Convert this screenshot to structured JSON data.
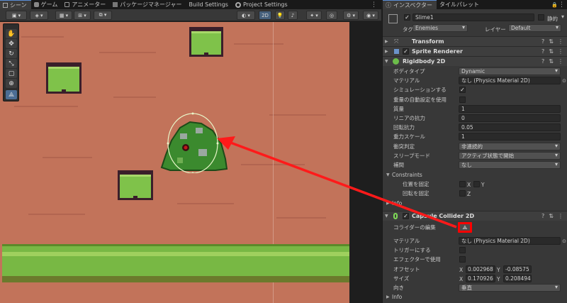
{
  "scene_tabs": [
    {
      "label": "シーン",
      "icon": "grid-icon",
      "active": true
    },
    {
      "label": "ゲーム",
      "icon": "gamepad-icon",
      "active": false
    },
    {
      "label": "アニメーター",
      "icon": "animator-icon",
      "active": false
    },
    {
      "label": "パッケージマネージャー",
      "icon": "package-icon",
      "active": false
    },
    {
      "label": "Build Settings",
      "icon": "",
      "active": false
    },
    {
      "label": "Project Settings",
      "icon": "gear-icon",
      "active": false
    }
  ],
  "scene_toolbar": {
    "mode_2d": "2D"
  },
  "tools": [
    "hand-icon",
    "move-icon",
    "rotate-icon",
    "scale-icon",
    "rect-icon",
    "transform-icon",
    "custom-tool-icon"
  ],
  "inspector": {
    "tabs": [
      {
        "label": "インスペクター",
        "icon": "info-icon",
        "active": true
      },
      {
        "label": "タイルパレット",
        "icon": "",
        "active": false
      }
    ],
    "object": {
      "name": "Slime1",
      "static_label": "静的",
      "tag_label": "タグ",
      "tag_value": "Enemies",
      "layer_label": "レイヤー",
      "layer_value": "Default"
    },
    "components": {
      "transform": "Transform",
      "sprite_renderer": "Sprite Renderer",
      "rigidbody": "Rigidbody 2D",
      "capsule": "Capsule Collider 2D"
    },
    "rigidbody_fields": [
      {
        "label": "ボディタイプ",
        "value": "Dynamic",
        "kind": "dropdown"
      },
      {
        "label": "マテリアル",
        "value": "なし (Physics Material 2D)",
        "kind": "object"
      },
      {
        "label": "シミュレーションする",
        "value": "✓",
        "kind": "check"
      },
      {
        "label": "重量の自動設定を使用",
        "value": "",
        "kind": "check"
      },
      {
        "label": "質量",
        "value": "1",
        "kind": "text"
      },
      {
        "label": "リニアの抗力",
        "value": "0",
        "kind": "text"
      },
      {
        "label": "回転抗力",
        "value": "0.05",
        "kind": "text"
      },
      {
        "label": "重力スケール",
        "value": "1",
        "kind": "text"
      },
      {
        "label": "衝突判定",
        "value": "非連続的",
        "kind": "dropdown"
      },
      {
        "label": "スリープモード",
        "value": "アクティブ状態で開始",
        "kind": "dropdown"
      },
      {
        "label": "補間",
        "value": "なし",
        "kind": "dropdown"
      }
    ],
    "constraints": {
      "title": "Constraints",
      "freeze_pos_label": "位置を固定",
      "freeze_rot_label": "回転を固定",
      "x": "X",
      "y": "Y",
      "z": "Z"
    },
    "info_label": "Info",
    "capsule_fields": {
      "edit_label": "コライダーの編集",
      "material_label": "マテリアル",
      "material_value": "なし (Physics Material 2D)",
      "trigger_label": "トリガーにする",
      "effector_label": "エフェクターで使用",
      "offset_label": "オフセット",
      "offset_x": "0.002968",
      "offset_y": "-0.08575",
      "size_label": "サイズ",
      "size_x": "0.170926",
      "size_y": "0.208494",
      "direction_label": "向き",
      "direction_value": "垂直",
      "x_label": "X",
      "y_label": "Y"
    }
  },
  "colors": {
    "highlight": "#ff0000",
    "accent": "#5a8dd6",
    "ground": "#c2735a",
    "grass": "#7fc24a"
  }
}
